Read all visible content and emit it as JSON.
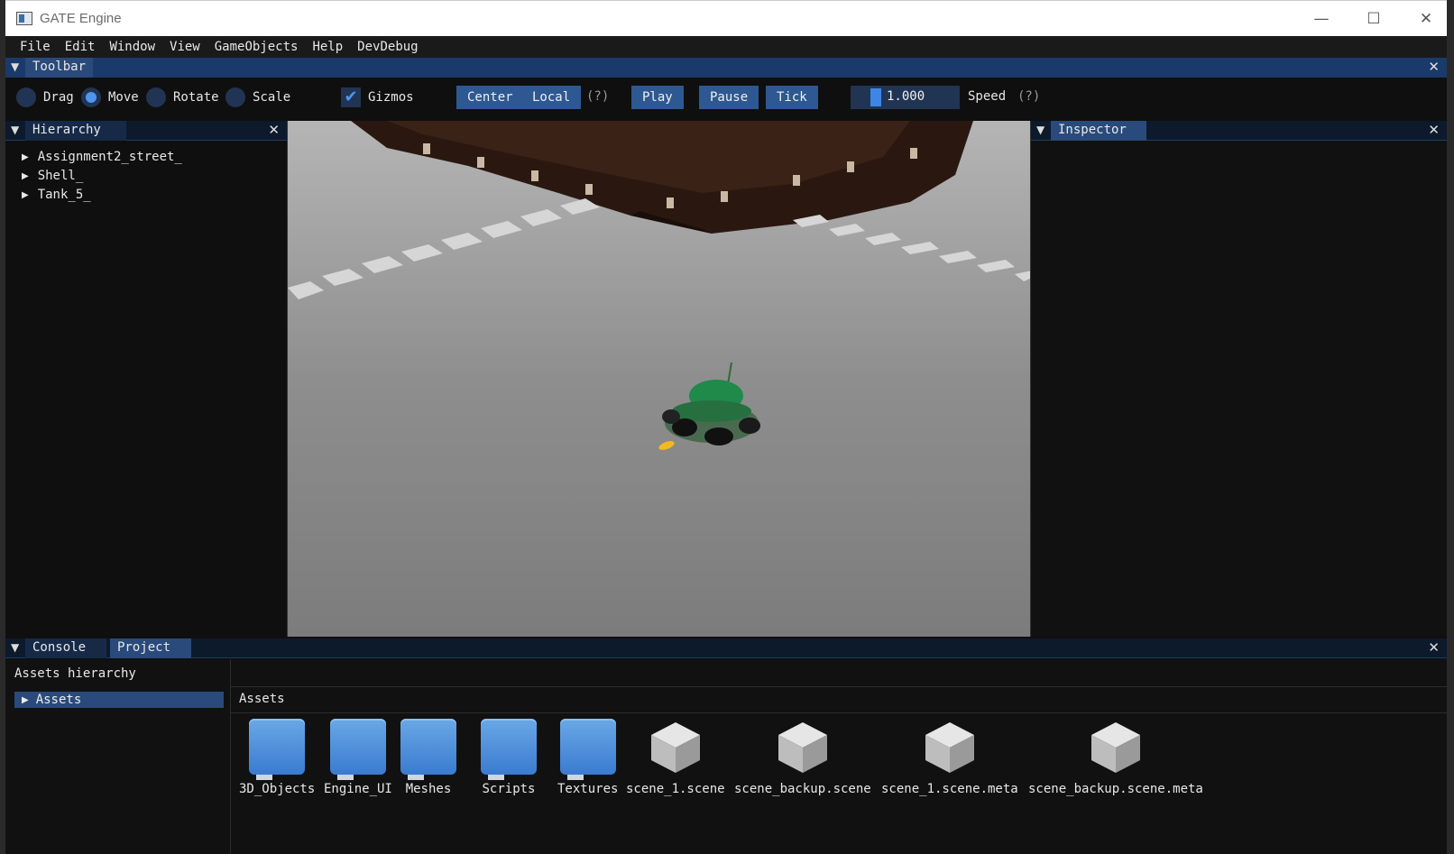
{
  "window": {
    "title": "GATE Engine",
    "minimize": "—",
    "maximize": "☐",
    "close": "✕"
  },
  "menu": [
    "File",
    "Edit",
    "Window",
    "View",
    "GameObjects",
    "Help",
    "DevDebug"
  ],
  "toolbar": {
    "tab": "Toolbar",
    "radios": [
      {
        "label": "Drag",
        "selected": false
      },
      {
        "label": "Move",
        "selected": true
      },
      {
        "label": "Rotate",
        "selected": false
      },
      {
        "label": "Scale",
        "selected": false
      }
    ],
    "gizmos": {
      "label": "Gizmos",
      "checked": true
    },
    "center": "Center",
    "local": "Local",
    "help1": "(?)",
    "play": "Play",
    "pause": "Pause",
    "tick": "Tick",
    "speed_value": "1.000",
    "speed_label": "Speed",
    "help2": "(?)"
  },
  "hierarchy": {
    "tab": "Hierarchy",
    "items": [
      "Assignment2_street_",
      "Shell_",
      "Tank_5_"
    ]
  },
  "inspector": {
    "tab": "Inspector"
  },
  "bottom": {
    "tabs": [
      "Console",
      "Project"
    ],
    "active_tab": "Project",
    "assets_hierarchy_label": "Assets hierarchy",
    "tree_root": "Assets",
    "path": "Assets",
    "assets": [
      {
        "name": "3D_Objects",
        "type": "folder"
      },
      {
        "name": "Engine_UI",
        "type": "folder"
      },
      {
        "name": "Meshes",
        "type": "folder"
      },
      {
        "name": "Scripts",
        "type": "folder"
      },
      {
        "name": "Textures",
        "type": "folder"
      },
      {
        "name": "scene_1.scene",
        "type": "file"
      },
      {
        "name": "scene_backup.scene",
        "type": "file"
      },
      {
        "name": "scene_1.scene.meta",
        "type": "file"
      },
      {
        "name": "scene_backup.scene.meta",
        "type": "file"
      }
    ]
  },
  "colors": {
    "accent": "#294a7a",
    "radio_on": "#4f95ee",
    "tank": "#1f8a4a",
    "shell": "#f5b820"
  }
}
